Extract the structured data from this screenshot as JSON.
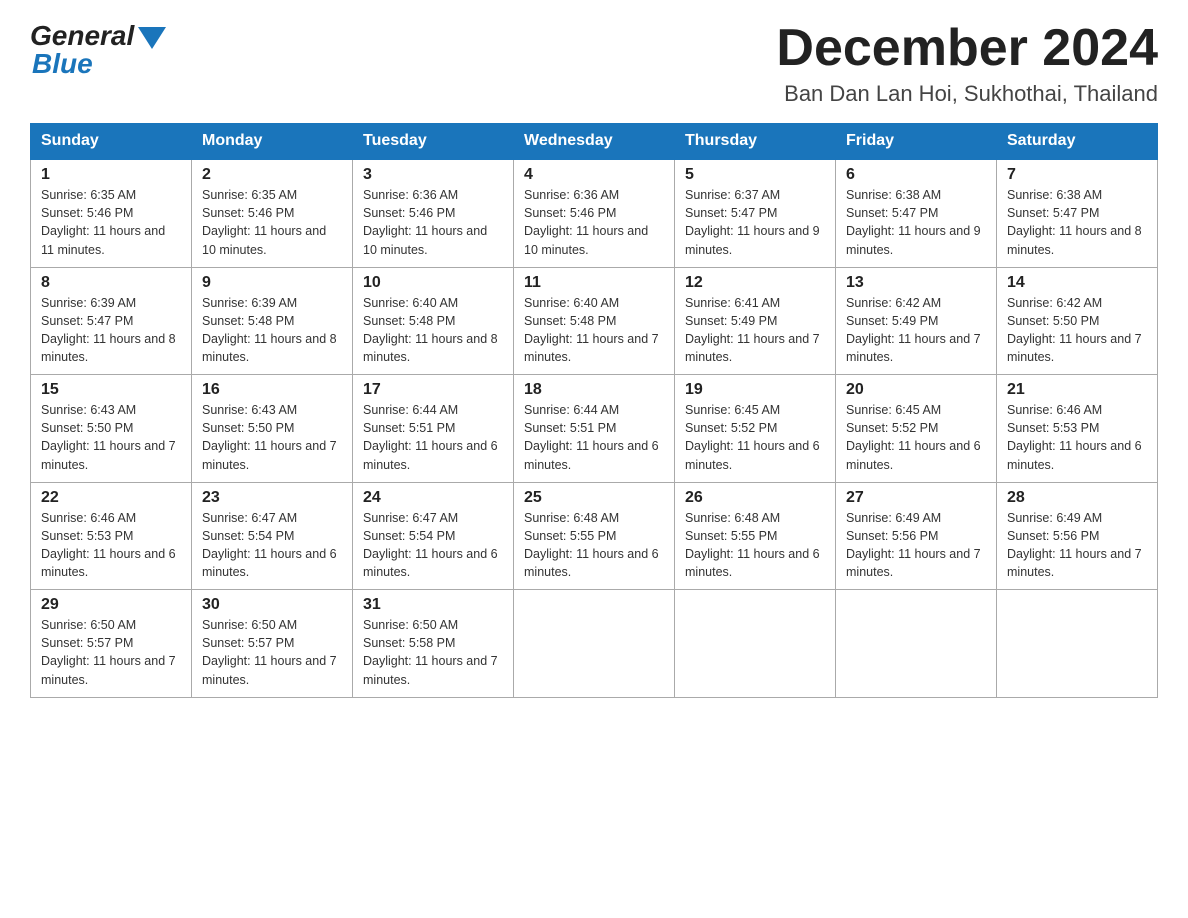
{
  "header": {
    "logo_general": "General",
    "logo_blue": "Blue",
    "month_year": "December 2024",
    "location": "Ban Dan Lan Hoi, Sukhothai, Thailand"
  },
  "days_of_week": [
    "Sunday",
    "Monday",
    "Tuesday",
    "Wednesday",
    "Thursday",
    "Friday",
    "Saturday"
  ],
  "weeks": [
    [
      {
        "day": "1",
        "sunrise": "6:35 AM",
        "sunset": "5:46 PM",
        "daylight": "11 hours and 11 minutes."
      },
      {
        "day": "2",
        "sunrise": "6:35 AM",
        "sunset": "5:46 PM",
        "daylight": "11 hours and 10 minutes."
      },
      {
        "day": "3",
        "sunrise": "6:36 AM",
        "sunset": "5:46 PM",
        "daylight": "11 hours and 10 minutes."
      },
      {
        "day": "4",
        "sunrise": "6:36 AM",
        "sunset": "5:46 PM",
        "daylight": "11 hours and 10 minutes."
      },
      {
        "day": "5",
        "sunrise": "6:37 AM",
        "sunset": "5:47 PM",
        "daylight": "11 hours and 9 minutes."
      },
      {
        "day": "6",
        "sunrise": "6:38 AM",
        "sunset": "5:47 PM",
        "daylight": "11 hours and 9 minutes."
      },
      {
        "day": "7",
        "sunrise": "6:38 AM",
        "sunset": "5:47 PM",
        "daylight": "11 hours and 8 minutes."
      }
    ],
    [
      {
        "day": "8",
        "sunrise": "6:39 AM",
        "sunset": "5:47 PM",
        "daylight": "11 hours and 8 minutes."
      },
      {
        "day": "9",
        "sunrise": "6:39 AM",
        "sunset": "5:48 PM",
        "daylight": "11 hours and 8 minutes."
      },
      {
        "day": "10",
        "sunrise": "6:40 AM",
        "sunset": "5:48 PM",
        "daylight": "11 hours and 8 minutes."
      },
      {
        "day": "11",
        "sunrise": "6:40 AM",
        "sunset": "5:48 PM",
        "daylight": "11 hours and 7 minutes."
      },
      {
        "day": "12",
        "sunrise": "6:41 AM",
        "sunset": "5:49 PM",
        "daylight": "11 hours and 7 minutes."
      },
      {
        "day": "13",
        "sunrise": "6:42 AM",
        "sunset": "5:49 PM",
        "daylight": "11 hours and 7 minutes."
      },
      {
        "day": "14",
        "sunrise": "6:42 AM",
        "sunset": "5:50 PM",
        "daylight": "11 hours and 7 minutes."
      }
    ],
    [
      {
        "day": "15",
        "sunrise": "6:43 AM",
        "sunset": "5:50 PM",
        "daylight": "11 hours and 7 minutes."
      },
      {
        "day": "16",
        "sunrise": "6:43 AM",
        "sunset": "5:50 PM",
        "daylight": "11 hours and 7 minutes."
      },
      {
        "day": "17",
        "sunrise": "6:44 AM",
        "sunset": "5:51 PM",
        "daylight": "11 hours and 6 minutes."
      },
      {
        "day": "18",
        "sunrise": "6:44 AM",
        "sunset": "5:51 PM",
        "daylight": "11 hours and 6 minutes."
      },
      {
        "day": "19",
        "sunrise": "6:45 AM",
        "sunset": "5:52 PM",
        "daylight": "11 hours and 6 minutes."
      },
      {
        "day": "20",
        "sunrise": "6:45 AM",
        "sunset": "5:52 PM",
        "daylight": "11 hours and 6 minutes."
      },
      {
        "day": "21",
        "sunrise": "6:46 AM",
        "sunset": "5:53 PM",
        "daylight": "11 hours and 6 minutes."
      }
    ],
    [
      {
        "day": "22",
        "sunrise": "6:46 AM",
        "sunset": "5:53 PM",
        "daylight": "11 hours and 6 minutes."
      },
      {
        "day": "23",
        "sunrise": "6:47 AM",
        "sunset": "5:54 PM",
        "daylight": "11 hours and 6 minutes."
      },
      {
        "day": "24",
        "sunrise": "6:47 AM",
        "sunset": "5:54 PM",
        "daylight": "11 hours and 6 minutes."
      },
      {
        "day": "25",
        "sunrise": "6:48 AM",
        "sunset": "5:55 PM",
        "daylight": "11 hours and 6 minutes."
      },
      {
        "day": "26",
        "sunrise": "6:48 AM",
        "sunset": "5:55 PM",
        "daylight": "11 hours and 6 minutes."
      },
      {
        "day": "27",
        "sunrise": "6:49 AM",
        "sunset": "5:56 PM",
        "daylight": "11 hours and 7 minutes."
      },
      {
        "day": "28",
        "sunrise": "6:49 AM",
        "sunset": "5:56 PM",
        "daylight": "11 hours and 7 minutes."
      }
    ],
    [
      {
        "day": "29",
        "sunrise": "6:50 AM",
        "sunset": "5:57 PM",
        "daylight": "11 hours and 7 minutes."
      },
      {
        "day": "30",
        "sunrise": "6:50 AM",
        "sunset": "5:57 PM",
        "daylight": "11 hours and 7 minutes."
      },
      {
        "day": "31",
        "sunrise": "6:50 AM",
        "sunset": "5:58 PM",
        "daylight": "11 hours and 7 minutes."
      },
      null,
      null,
      null,
      null
    ]
  ]
}
